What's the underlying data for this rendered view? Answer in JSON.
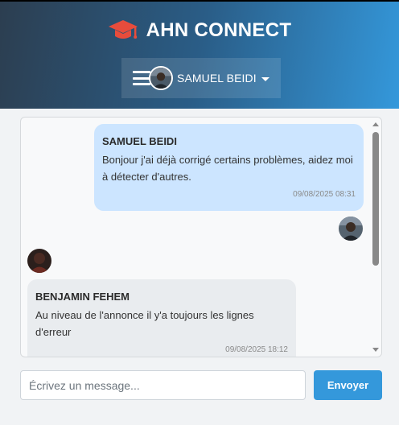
{
  "app": {
    "title": "AHN CONNECT",
    "icon": "graduation-cap-icon",
    "brand_color": "#e74c3c"
  },
  "user_menu": {
    "name": "SAMUEL BEIDI",
    "menu_icon": "hamburger-icon",
    "dropdown_icon": "caret-down-icon"
  },
  "messages": [
    {
      "author": "SAMUEL BEIDI",
      "text": "Bonjour j'ai déjà corrigé certains problèmes, aidez moi à détecter d'autres.",
      "time": "09/08/2025 08:31",
      "direction": "sent",
      "bubble_color": "#cce5ff"
    },
    {
      "author": "BENJAMIN FEHEM",
      "text": "Au niveau de l'annonce il y'a toujours les lignes d'erreur",
      "time": "09/08/2025 18:12",
      "direction": "received",
      "bubble_color": "#e9ecef"
    }
  ],
  "composer": {
    "placeholder": "Écrivez un message...",
    "value": "",
    "send_label": "Envoyer",
    "send_color": "#3498db"
  }
}
